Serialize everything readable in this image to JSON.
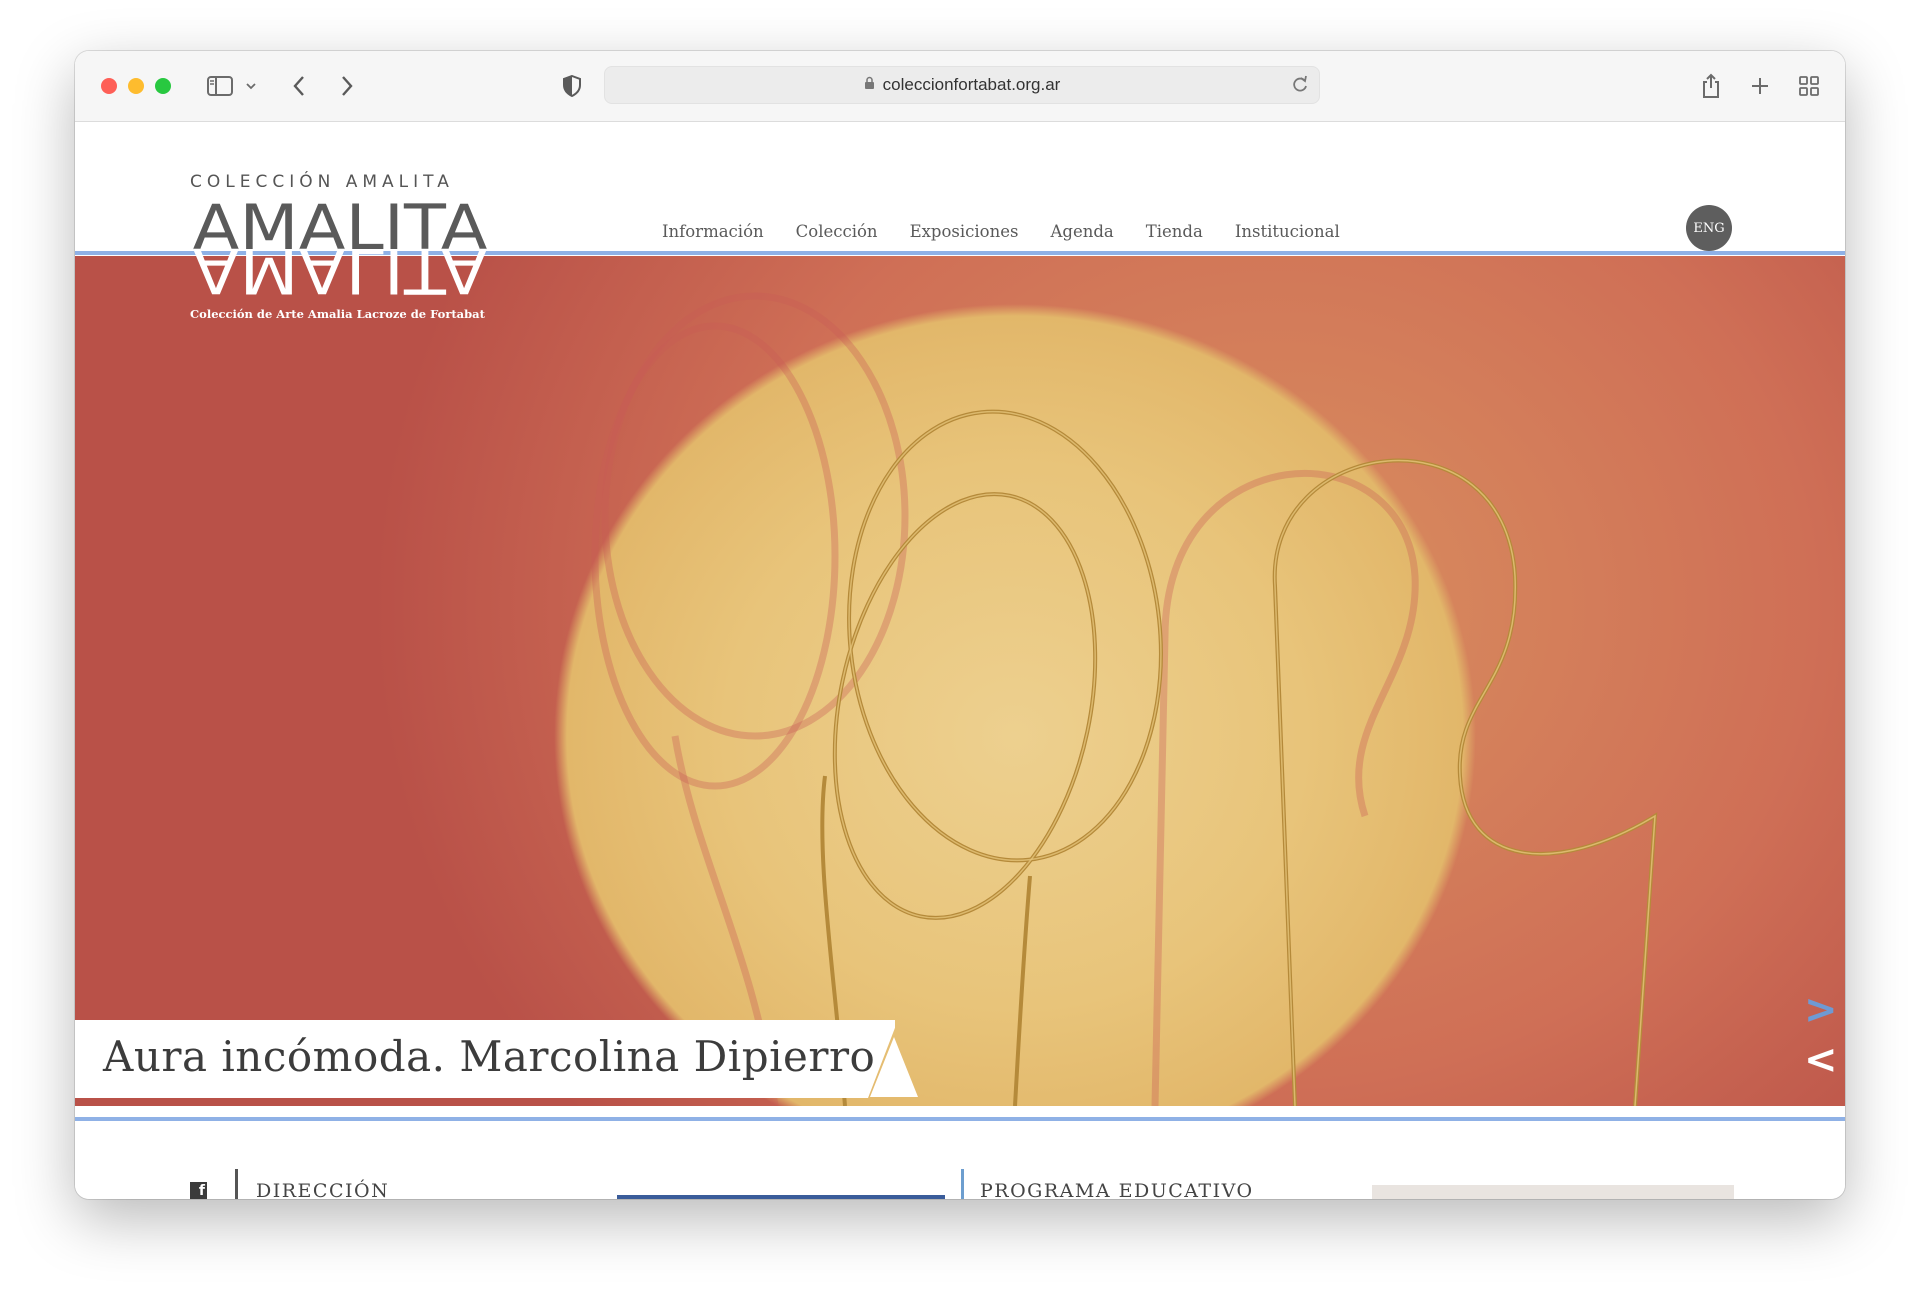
{
  "browser": {
    "url": "coleccionfortabat.org.ar"
  },
  "site": {
    "logo_top": "COLECCIÓN AMALITA",
    "logo_word": "AMALITA",
    "logo_sub": "Colección de Arte Amalia Lacroze de Fortabat"
  },
  "nav": {
    "items": [
      "Información",
      "Colección",
      "Exposiciones",
      "Agenda",
      "Tienda",
      "Institucional"
    ]
  },
  "lang_button": "ENG",
  "hero": {
    "caption": "Aura incómoda. Marcolina Dipierro",
    "next_label": ">",
    "prev_label": "<"
  },
  "sections": {
    "left_title": "DIRECCIÓN",
    "right_title": "PROGRAMA EDUCATIVO"
  }
}
